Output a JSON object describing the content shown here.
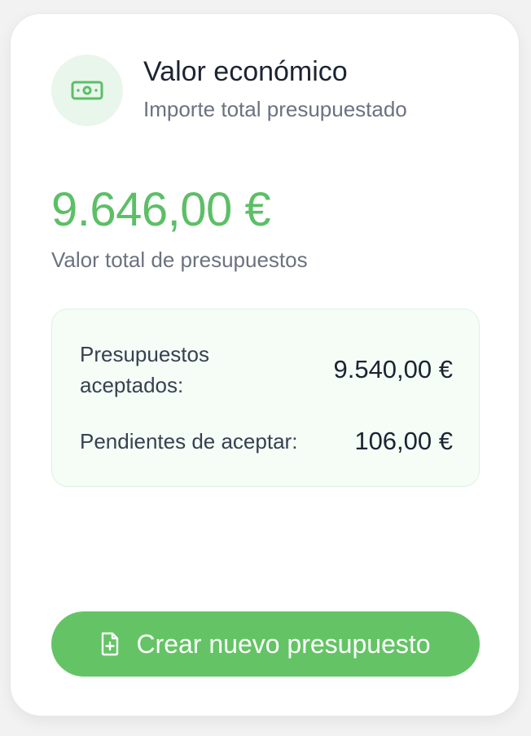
{
  "header": {
    "icon": "banknote-icon",
    "title": "Valor económico",
    "subtitle": "Importe total presupuestado"
  },
  "summary": {
    "total_value": "9.646,00 €",
    "total_label": "Valor total de presupuestos"
  },
  "breakdown": {
    "accepted_label": "Presupuestos aceptados:",
    "accepted_value": "9.540,00 €",
    "pending_label": "Pendientes de aceptar:",
    "pending_value": "106,00 €"
  },
  "actions": {
    "create_icon": "file-plus-icon",
    "create_label": "Crear nuevo presupuesto"
  },
  "colors": {
    "accent": "#64c465",
    "total_value": "#5cbf66",
    "icon_bg": "#e9f6ec",
    "panel_bg": "#f5fdf6"
  }
}
